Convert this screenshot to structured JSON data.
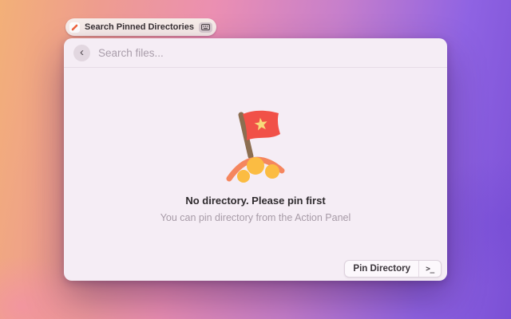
{
  "launcher_pill": {
    "label": "Search Pinned Directories",
    "icon": "pin-app-icon",
    "hotkey_icon": "keyboard-icon"
  },
  "window": {
    "search": {
      "back_glyph": "‹",
      "placeholder": "Search files..."
    },
    "empty_state": {
      "illustration": "flag-on-hill-illustration",
      "title": "No directory. Please pin first",
      "subtitle": "You can pin directory from the Action Panel"
    },
    "actions": {
      "pin_button_label": "Pin Directory",
      "shortcut_glyph": ">_"
    }
  },
  "colors": {
    "flag_red": "#f15148",
    "star_yellow": "#f8da7a",
    "pole_brown": "#8c6e50",
    "arc_orange": "#f5865e",
    "dot_amber": "#fbbc42",
    "pin_accent": "#f0653e",
    "window_bg": "#f5edf5",
    "bg_gradient_left": "#f3b078",
    "bg_gradient_mid": "#eb8fb2",
    "bg_gradient_right": "#7b50d5"
  }
}
